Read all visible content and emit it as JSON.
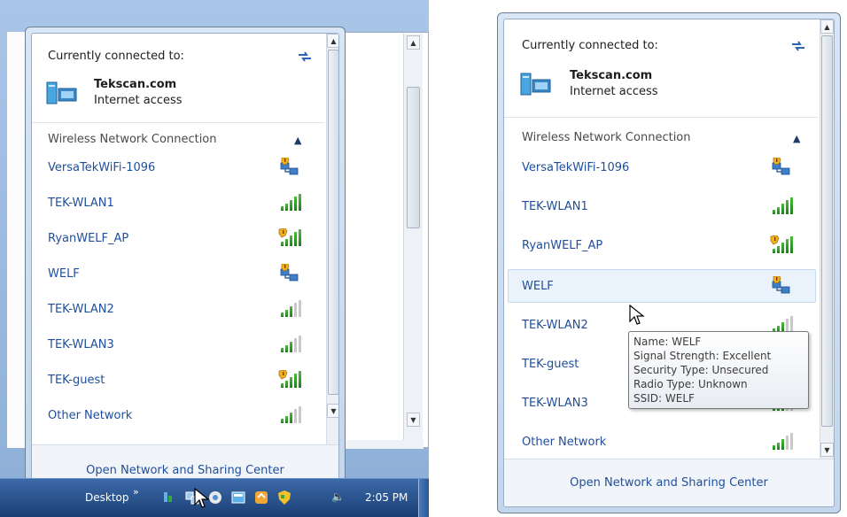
{
  "left_panel": {
    "header_label": "Currently connected to:",
    "connection": {
      "name": "Tekscan.com",
      "status": "Internet access"
    },
    "section_label": "Wireless Network Connection",
    "networks": [
      {
        "name": "VersaTekWiFi-1096",
        "icon": "unsecured-network-icon"
      },
      {
        "name": "TEK-WLAN1",
        "icon": "signal-full-icon"
      },
      {
        "name": "RyanWELF_AP",
        "icon": "signal-shield-icon"
      },
      {
        "name": "WELF",
        "icon": "unsecured-network-icon"
      },
      {
        "name": "TEK-WLAN2",
        "icon": "signal-medium-icon"
      },
      {
        "name": "TEK-WLAN3",
        "icon": "signal-medium-icon"
      },
      {
        "name": "TEK-guest",
        "icon": "signal-shield-icon"
      },
      {
        "name": "Other Network",
        "icon": "signal-medium-icon"
      }
    ],
    "footer_link": "Open Network and Sharing Center"
  },
  "taskbar": {
    "desktop_label": "Desktop",
    "chevron": "»",
    "volume": "🔈",
    "time": "2:05 PM"
  },
  "right_panel": {
    "header_label": "Currently connected to:",
    "connection": {
      "name": "Tekscan.com",
      "status": "Internet access"
    },
    "section_label": "Wireless Network Connection",
    "networks": [
      {
        "name": "VersaTekWiFi-1096",
        "icon": "unsecured-network-icon"
      },
      {
        "name": "TEK-WLAN1",
        "icon": "signal-full-icon"
      },
      {
        "name": "RyanWELF_AP",
        "icon": "signal-shield-icon"
      },
      {
        "name": "WELF",
        "icon": "unsecured-network-icon"
      },
      {
        "name": "TEK-WLAN2",
        "icon": "signal-medium-icon"
      },
      {
        "name": "TEK-guest",
        "icon": "signal-shield-icon"
      },
      {
        "name": "TEK-WLAN3",
        "icon": "signal-medium-icon"
      },
      {
        "name": "Other Network",
        "icon": "signal-medium-icon"
      }
    ],
    "footer_link": "Open Network and Sharing Center",
    "tooltip": {
      "name": "Name: WELF",
      "signal": "Signal Strength: Excellent",
      "security": "Security Type: Unsecured",
      "radio": "Radio Type: Unknown",
      "ssid": "SSID: WELF"
    }
  },
  "colors": {
    "link": "#1f4e9c",
    "taskbar": "#1b3f74",
    "frame": "#c3d6ec"
  }
}
